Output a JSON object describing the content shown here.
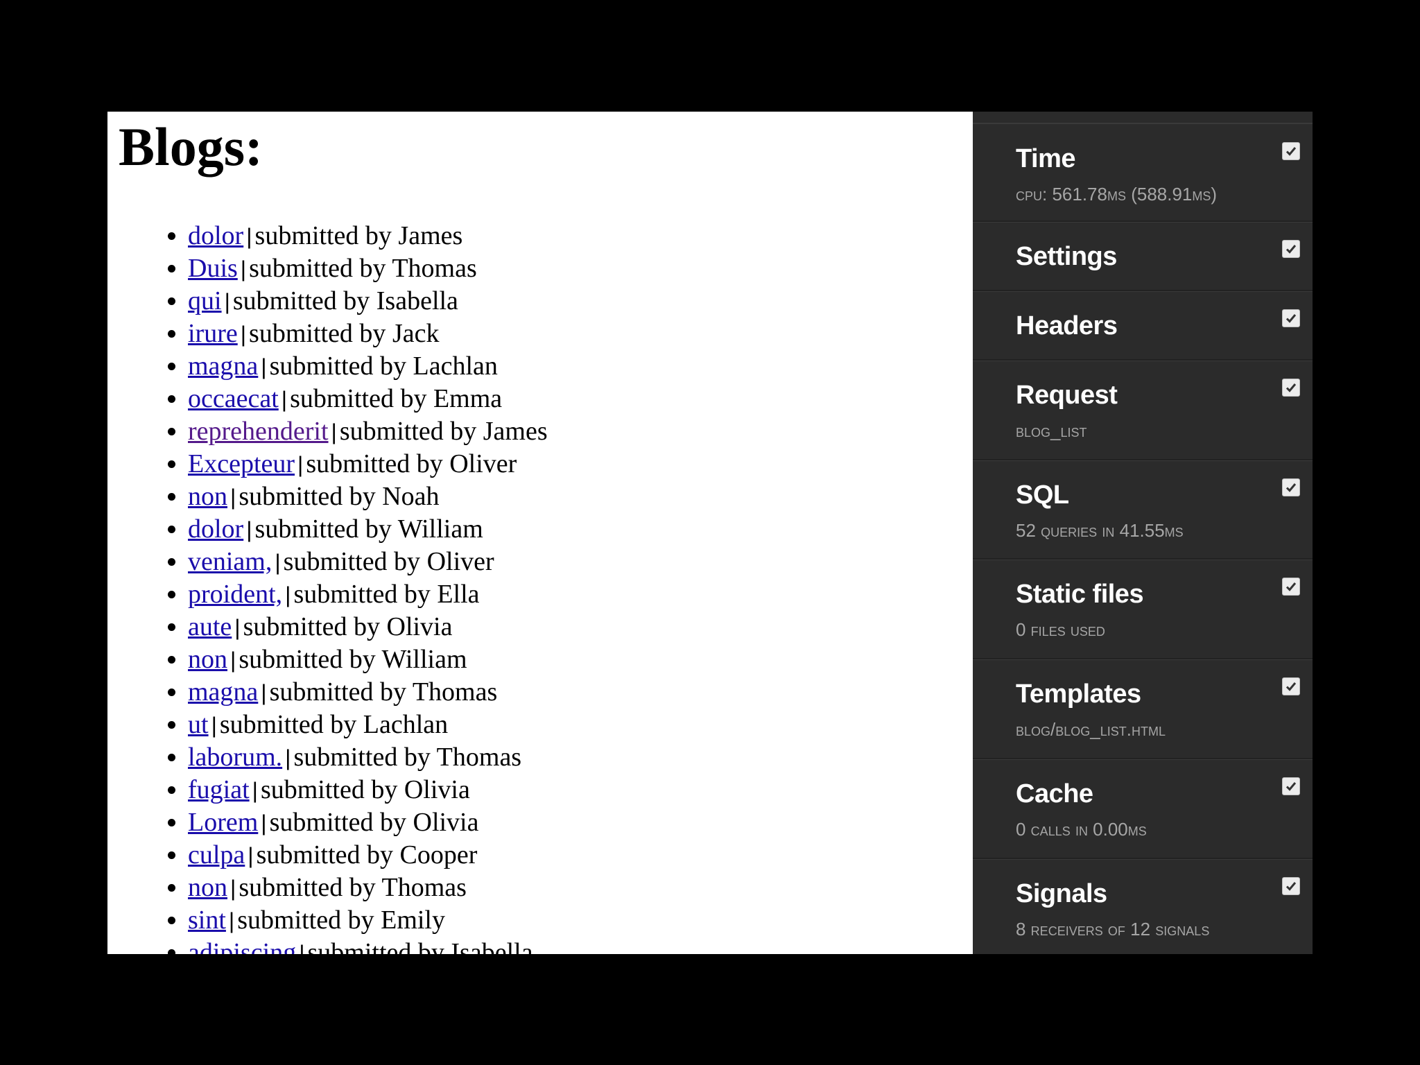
{
  "page": {
    "title": "Blogs:",
    "separator": "|",
    "submitted_prefix": "submitted by",
    "blogs": [
      {
        "title": "dolor",
        "author": "James",
        "visited": false
      },
      {
        "title": "Duis",
        "author": "Thomas",
        "visited": false
      },
      {
        "title": "qui",
        "author": "Isabella",
        "visited": false
      },
      {
        "title": "irure",
        "author": "Jack",
        "visited": false
      },
      {
        "title": "magna",
        "author": "Lachlan",
        "visited": false
      },
      {
        "title": "occaecat",
        "author": "Emma",
        "visited": false
      },
      {
        "title": "reprehenderit",
        "author": "James",
        "visited": true
      },
      {
        "title": "Excepteur",
        "author": "Oliver",
        "visited": false
      },
      {
        "title": "non",
        "author": "Noah",
        "visited": false
      },
      {
        "title": "dolor",
        "author": "William",
        "visited": false
      },
      {
        "title": "veniam,",
        "author": "Oliver",
        "visited": false
      },
      {
        "title": "proident,",
        "author": "Ella",
        "visited": false
      },
      {
        "title": "aute",
        "author": "Olivia",
        "visited": false
      },
      {
        "title": "non",
        "author": "William",
        "visited": false
      },
      {
        "title": "magna",
        "author": "Thomas",
        "visited": false
      },
      {
        "title": "ut",
        "author": "Lachlan",
        "visited": false
      },
      {
        "title": "laborum.",
        "author": "Thomas",
        "visited": false
      },
      {
        "title": "fugiat",
        "author": "Olivia",
        "visited": false
      },
      {
        "title": "Lorem",
        "author": "Olivia",
        "visited": false
      },
      {
        "title": "culpa",
        "author": "Cooper",
        "visited": false
      },
      {
        "title": "non",
        "author": "Thomas",
        "visited": false
      },
      {
        "title": "sint",
        "author": "Emily",
        "visited": false
      },
      {
        "title": "adipiscing",
        "author": "Isabella",
        "visited": false
      }
    ]
  },
  "toolbar": {
    "panels": [
      {
        "key": "time",
        "title": "Time",
        "subtitle": "CPU: 561.78ms (588.91ms)",
        "checked": true
      },
      {
        "key": "settings",
        "title": "Settings",
        "subtitle": "",
        "checked": true
      },
      {
        "key": "headers",
        "title": "Headers",
        "subtitle": "",
        "checked": true
      },
      {
        "key": "request",
        "title": "Request",
        "subtitle": "blog_list",
        "checked": true
      },
      {
        "key": "sql",
        "title": "SQL",
        "subtitle": "52 queries in 41.55ms",
        "checked": true
      },
      {
        "key": "static",
        "title": "Static files",
        "subtitle": "0 files used",
        "checked": true
      },
      {
        "key": "templates",
        "title": "Templates",
        "subtitle": "blog/blog_list.html",
        "checked": true
      },
      {
        "key": "cache",
        "title": "Cache",
        "subtitle": "0 calls in 0.00ms",
        "checked": true
      },
      {
        "key": "signals",
        "title": "Signals",
        "subtitle": "8 receivers of 12 signals",
        "checked": true
      }
    ]
  },
  "colors": {
    "link": "#1a0dab",
    "link_visited": "#551a8b",
    "toolbar_bg": "#2b2b2b",
    "toolbar_title": "#ffffff",
    "toolbar_sub": "#a6a6a6",
    "outer_bg": "#000000"
  }
}
